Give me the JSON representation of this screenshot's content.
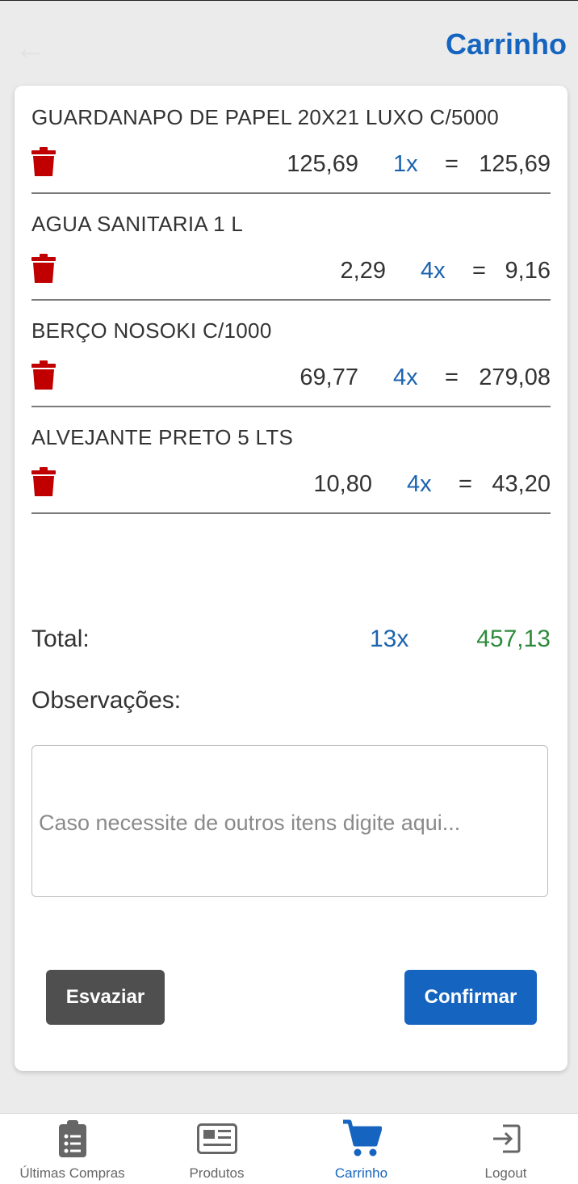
{
  "header": {
    "title": "Carrinho",
    "back_icon": "arrow-left-icon"
  },
  "cart": {
    "items": [
      {
        "name": "GUARDANAPO DE PAPEL 20X21 LUXO C/5000",
        "price": "125,69",
        "qty": "1x",
        "eq": "=",
        "subtotal": "125,69"
      },
      {
        "name": "AGUA SANITARIA 1 L",
        "price": "2,29",
        "qty": "4x",
        "eq": "=",
        "subtotal": "9,16"
      },
      {
        "name": "BERÇO NOSOKI C/1000",
        "price": "69,77",
        "qty": "4x",
        "eq": "=",
        "subtotal": "279,08"
      },
      {
        "name": "ALVEJANTE PRETO 5 LTS",
        "price": "10,80",
        "qty": "4x",
        "eq": "=",
        "subtotal": "43,20"
      }
    ],
    "total_label": "Total:",
    "total_qty": "13x",
    "total_value": "457,13",
    "obs_label": "Observações:",
    "obs_value": "",
    "obs_placeholder": "Caso necessite de outros itens digite aqui...",
    "clear_label": "Esvaziar",
    "confirm_label": "Confirmar"
  },
  "nav": [
    {
      "label": "Últimas Compras",
      "icon": "clipboard-list-icon",
      "active": false
    },
    {
      "label": "Produtos",
      "icon": "newspaper-icon",
      "active": false
    },
    {
      "label": "Carrinho",
      "icon": "cart-icon",
      "active": true
    },
    {
      "label": "Logout",
      "icon": "logout-icon",
      "active": false
    }
  ],
  "colors": {
    "accent": "#1565c0",
    "quantity": "#1b63b0",
    "total": "#2e8b3a",
    "trash": "#c00000",
    "clear_button": "#4f4f4f"
  }
}
